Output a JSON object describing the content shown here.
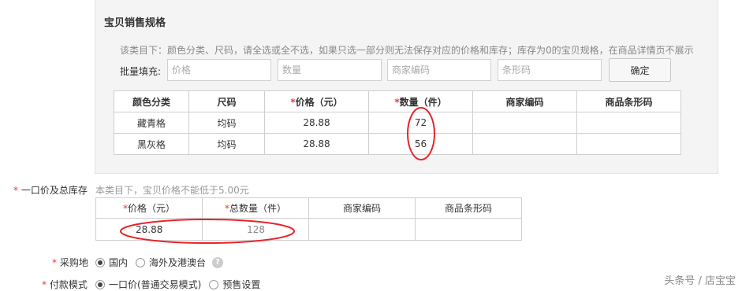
{
  "sku": {
    "title": "宝贝销售规格",
    "note": "该类目下：颜色分类、尺码，请全选或全不选，如果只选一部分则无法保存对应的价格和库存；库存为0的宝贝规格，在商品详情页不展示",
    "fill_label": "批量填充:",
    "fill_inputs": {
      "price": "价格",
      "qty": "数量",
      "merchant_code": "商家编码",
      "barcode": "条形码"
    },
    "confirm_label": "确定",
    "headers": [
      "颜色分类",
      "尺码",
      "价格（元）",
      "数量（件）",
      "商家编码",
      "商品条形码"
    ],
    "required_mark": "*",
    "rows": [
      {
        "color": "藏青格",
        "size": "均码",
        "price": "28.88",
        "qty": "72",
        "code": "",
        "barcode": ""
      },
      {
        "color": "黑灰格",
        "size": "均码",
        "price": "28.88",
        "qty": "56",
        "code": "",
        "barcode": ""
      }
    ]
  },
  "price_section": {
    "label_mark": "*",
    "label": "一口价及总库存",
    "note": "本类目下，宝贝价格不能低于5.00元",
    "headers": [
      "价格（元）",
      "总数量（件）",
      "商家编码",
      "商品条形码"
    ],
    "values": {
      "price": "28.88",
      "total_qty": "128",
      "code": "",
      "barcode": ""
    }
  },
  "origin": {
    "label_mark": "*",
    "label": "采购地",
    "options": [
      "国内",
      "海外及港澳台"
    ],
    "selected": "国内",
    "help_icon": "question-circle-icon"
  },
  "payment": {
    "label_mark": "*",
    "label": "付款模式",
    "options": [
      "一口价(普通交易模式)",
      "预售设置"
    ],
    "selected": "一口价(普通交易模式)"
  },
  "watermark": "头条号 / 店宝宝",
  "colors": {
    "required": "#e4393c",
    "annotation": "#e8232a",
    "panel_bg": "#f4f4f4"
  }
}
